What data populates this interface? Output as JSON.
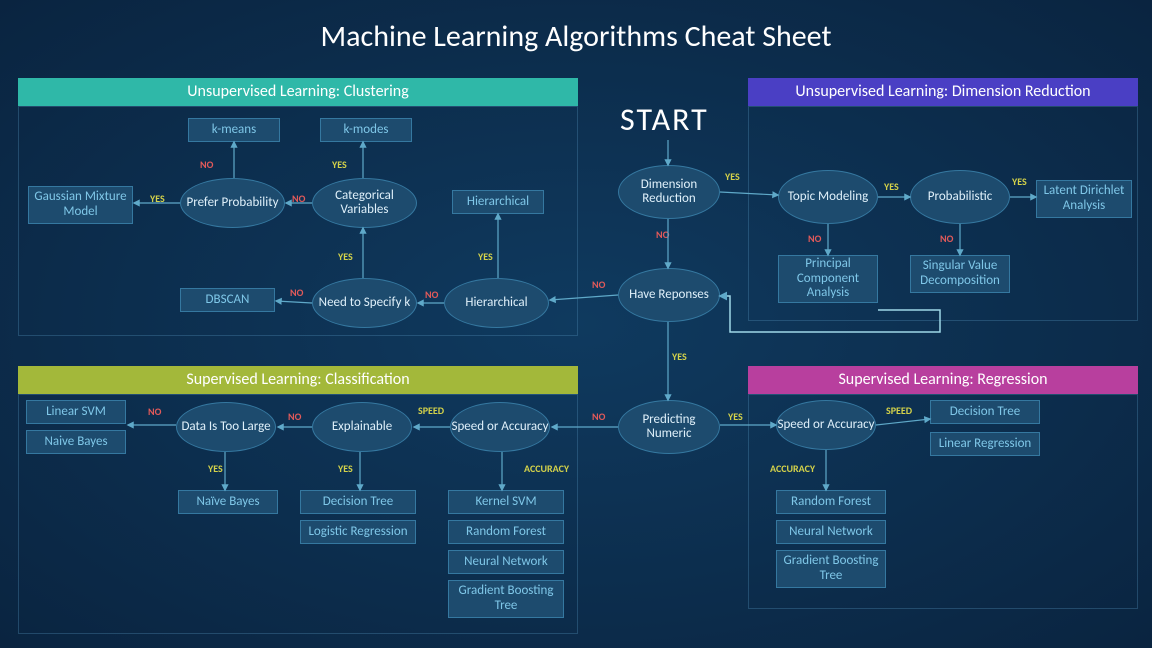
{
  "title": "Machine Learning Algorithms Cheat Sheet",
  "start": "START",
  "sections": {
    "clustering": "Unsupervised Learning: Clustering",
    "dimred": "Unsupervised Learning: Dimension Reduction",
    "classification": "Supervised Learning: Classification",
    "regression": "Supervised Learning: Regression"
  },
  "decisions": {
    "dim_reduction": "Dimension Reduction",
    "have_responses": "Have Reponses",
    "predicting_numeric": "Predicting Numeric",
    "prefer_probability": "Prefer Probability",
    "categorical_vars": "Categorical Variables",
    "need_specify_k": "Need to Specify k",
    "hierarchical_q": "Hierarchical",
    "topic_modeling": "Topic Modeling",
    "probabilistic": "Probabilistic",
    "data_too_large": "Data Is Too Large",
    "explainable": "Explainable",
    "speed_or_accuracy_c": "Speed or Accuracy",
    "speed_or_accuracy_r": "Speed or Accuracy"
  },
  "algos": {
    "kmeans": "k-means",
    "kmodes": "k-modes",
    "gmm": "Gaussian Mixture Model",
    "dbscan": "DBSCAN",
    "hierarchical": "Hierarchical",
    "lda": "Latent Dirichlet Analysis",
    "pca": "Principal Component Analysis",
    "svd": "Singular Value Decomposition",
    "linear_svm": "Linear SVM",
    "naive_bayes": "Naive Bayes",
    "naive_bayes2": "Naïve Bayes",
    "decision_tree_c": "Decision Tree",
    "logistic_regression": "Logistic Regression",
    "kernel_svm": "Kernel SVM",
    "random_forest_c": "Random Forest",
    "neural_net_c": "Neural Network",
    "gbt_c": "Gradient Boosting Tree",
    "decision_tree_r": "Decision Tree",
    "linear_regression": "Linear Regression",
    "random_forest_r": "Random Forest",
    "neural_net_r": "Neural Network",
    "gbt_r": "Gradient Boosting Tree"
  },
  "labels": {
    "yes": "YES",
    "no": "NO",
    "speed": "SPEED",
    "accuracy": "ACCURACY"
  }
}
